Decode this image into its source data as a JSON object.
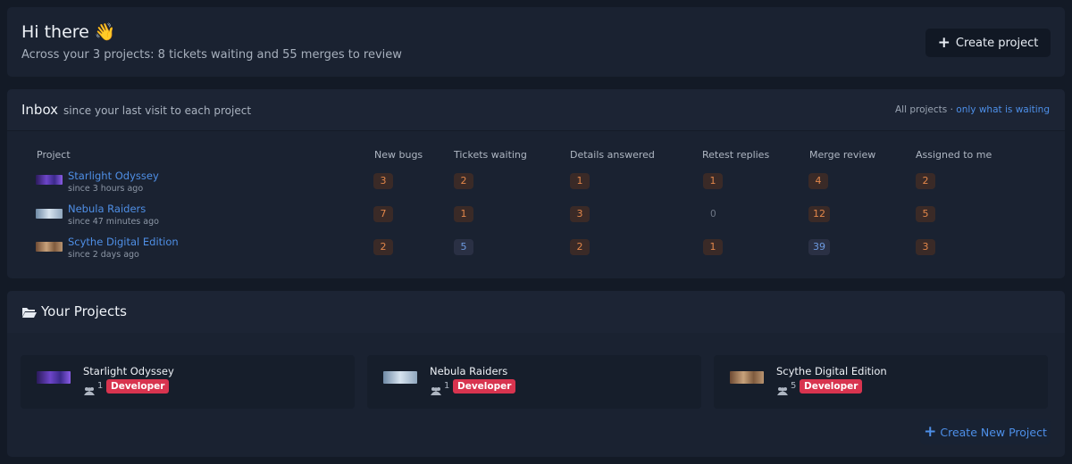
{
  "header": {
    "title": "Hi there 👋",
    "subtitle": "Across your 3 projects: 8 tickets waiting and 55 merges to review",
    "create_label": "Create project"
  },
  "inbox": {
    "title": "Inbox",
    "subtitle": "since your last visit to each project",
    "filter_all": "All projects",
    "filter_sep": "·",
    "filter_waiting": "only what is waiting",
    "columns": [
      "Project",
      "New bugs",
      "Tickets waiting",
      "Details answered",
      "Retest replies",
      "Merge review",
      "Assigned to me"
    ],
    "rows": [
      {
        "name": "Starlight Odyssey",
        "since": "since 3 hours ago",
        "thumb": "starlight-thumbnail",
        "values": [
          "3",
          "2",
          "1",
          "1",
          "4",
          "2"
        ]
      },
      {
        "name": "Nebula Raiders",
        "since": "since 47 minutes ago",
        "thumb": "nebula-thumbnail",
        "values": [
          "7",
          "1",
          "3",
          "0",
          "12",
          "5"
        ]
      },
      {
        "name": "Scythe Digital Edition",
        "since": "since 2 days ago",
        "thumb": "scythe-thumbnail",
        "values": [
          "2",
          "5",
          "2",
          "1",
          "39",
          "3"
        ]
      }
    ],
    "colors": {
      "orange_pill": "#e3874a",
      "blue_pill": "#6d9ae0"
    }
  },
  "projects": {
    "title": "Your Projects",
    "items": [
      {
        "name": "Starlight Odyssey",
        "users": "1",
        "role": "Developer"
      },
      {
        "name": "Nebula Raiders",
        "users": "1",
        "role": "Developer"
      },
      {
        "name": "Scythe Digital Edition",
        "users": "5",
        "role": "Developer"
      }
    ],
    "create_label": "Create New Project"
  }
}
